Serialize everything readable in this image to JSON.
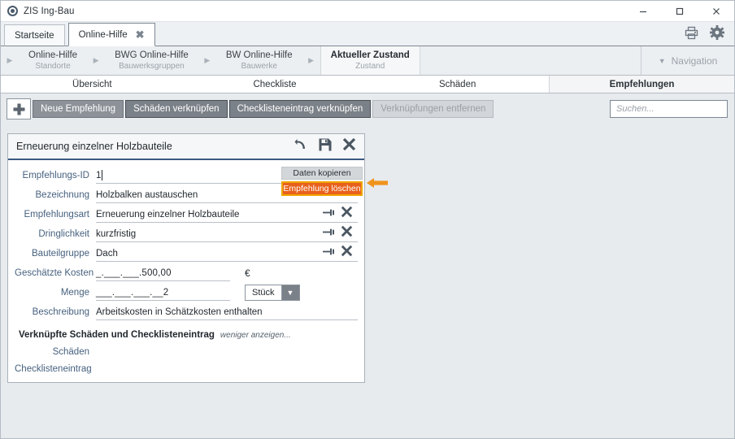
{
  "window": {
    "title": "ZIS Ing-Bau",
    "app_icon": "circle-target-icon",
    "minimize": "minimize-icon",
    "maximize": "maximize-icon",
    "close": "close-icon"
  },
  "tabs": [
    {
      "label": "Startseite",
      "active": false,
      "closable": false
    },
    {
      "label": "Online-Hilfe",
      "active": true,
      "closable": true,
      "close_glyph": "✖"
    }
  ],
  "tabbar_icons": [
    {
      "name": "printer-icon"
    },
    {
      "name": "gear-icon"
    }
  ],
  "breadcrumb": {
    "separator": "▶",
    "crumbs": [
      {
        "title": "Online-Hilfe",
        "subtitle": "Standorte",
        "active": false
      },
      {
        "title": "BWG Online-Hilfe",
        "subtitle": "Bauwerksgruppen",
        "active": false
      },
      {
        "title": "BW Online-Hilfe",
        "subtitle": "Bauwerke",
        "active": false
      },
      {
        "title": "Aktueller Zustand",
        "subtitle": "Zustand",
        "active": true
      }
    ],
    "navigation": {
      "label": "Navigation",
      "caret": "▼"
    }
  },
  "section_tabs": [
    {
      "label": "Übersicht",
      "active": false
    },
    {
      "label": "Checkliste",
      "active": false
    },
    {
      "label": "Schäden",
      "active": false
    },
    {
      "label": "Empfehlungen",
      "active": true
    }
  ],
  "toolbar": {
    "add_icon": "plus-icon",
    "buttons": [
      {
        "label": "Neue Empfehlung",
        "style": "normal"
      },
      {
        "label": "Schäden verknüpfen",
        "style": "dark"
      },
      {
        "label": "Checklisteneintrag verknüpfen",
        "style": "dark"
      },
      {
        "label": "Verknüpfungen entfernen",
        "style": "disabled"
      }
    ],
    "search": {
      "placeholder": "Suchen...",
      "value": "",
      "icon": "search-icon"
    }
  },
  "card": {
    "title": "Erneuerung einzelner Holzbauteile",
    "icons": [
      {
        "name": "undo-icon"
      },
      {
        "name": "save-icon"
      },
      {
        "name": "close-icon"
      }
    ],
    "fields": [
      {
        "label": "Empfehlungs-ID",
        "value": "1",
        "focused": true,
        "icons": false
      },
      {
        "label": "Bezeichnung",
        "value": "Holzbalken austauschen",
        "focused": false,
        "icons": false
      },
      {
        "label": "Empfehlungsart",
        "value": "Erneuerung einzelner Holzbauteile",
        "focused": false,
        "icons": true
      },
      {
        "label": "Dringlichkeit",
        "value": "kurzfristig",
        "focused": false,
        "icons": true
      },
      {
        "label": "Bauteilgruppe",
        "value": "Dach",
        "focused": false,
        "icons": true
      }
    ],
    "cost": {
      "label": "Geschätzte Kosten",
      "value": "_.___.___.500,00",
      "currency": "€"
    },
    "quantity": {
      "label": "Menge",
      "value": "___.___.___.__2",
      "unit": "Stück",
      "unit_caret": "▼"
    },
    "description": {
      "label": "Beschreibung",
      "value": "Arbeitskosten in Schätzkosten enthalten"
    },
    "linked": {
      "heading": "Verknüpfte Schäden und Checklisteneintrag",
      "toggle": "weniger anzeigen...",
      "rows": [
        {
          "label": "Schäden"
        },
        {
          "label": "Checklisteneintrag"
        }
      ]
    }
  },
  "side_buttons": [
    {
      "label": "Daten kopieren",
      "style": "normal"
    },
    {
      "label": "Empfehlung löschen",
      "style": "danger"
    }
  ],
  "annotation": {
    "arrow": "left-arrow-highlight",
    "color": "#f0941e"
  },
  "colors": {
    "accent": "#3d5a80",
    "danger": "#e8611c",
    "danger_border": "#f0a500",
    "label": "#46617f",
    "window_bg": "#e7ebee"
  }
}
